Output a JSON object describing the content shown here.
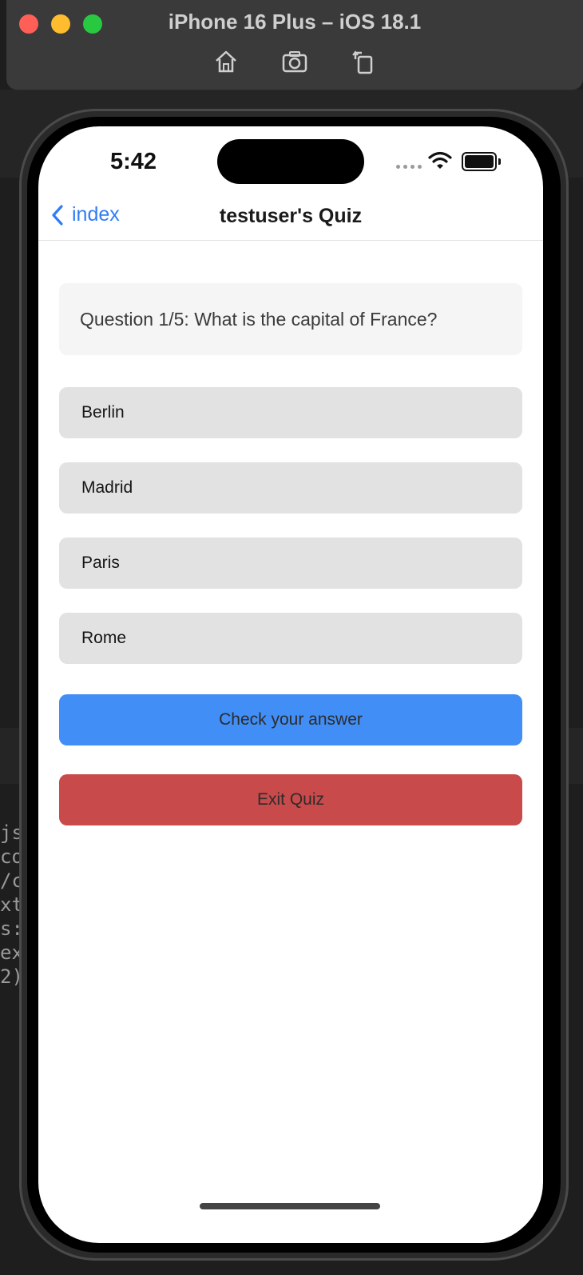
{
  "simulator": {
    "title": "iPhone 16 Plus – iOS 18.1",
    "tools": [
      "home-icon",
      "screenshot-icon",
      "rotate-icon"
    ]
  },
  "background": {
    "code_lines": [
      "js",
      "co",
      "/c",
      "xt",
      "s:",
      "",
      "ex",
      "",
      "2)"
    ]
  },
  "status_bar": {
    "time": "5:42"
  },
  "nav": {
    "back_label": "index",
    "title": "testuser's Quiz"
  },
  "quiz": {
    "question": "Question 1/5: What is the capital of France?",
    "answers": [
      "Berlin",
      "Madrid",
      "Paris",
      "Rome"
    ],
    "check_label": "Check your answer",
    "exit_label": "Exit Quiz"
  },
  "colors": {
    "accent": "#2f7df6",
    "check_button": "#418ef6",
    "exit_button": "#c84a4a",
    "answer_bg": "#e2e2e2",
    "question_bg": "#f5f5f5"
  }
}
